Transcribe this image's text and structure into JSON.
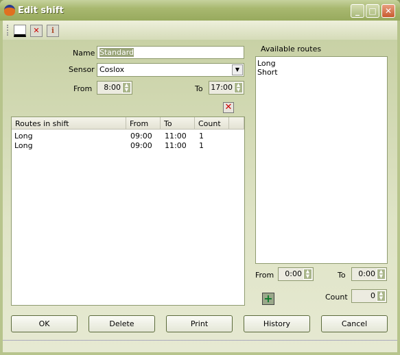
{
  "window": {
    "title": "Edit shift",
    "minimize": "_",
    "maximize": "□",
    "close": "✕"
  },
  "toolbar": {
    "items": [
      {
        "icon": "sensor-icon"
      },
      {
        "icon": "delete-icon"
      },
      {
        "icon": "info-icon"
      }
    ]
  },
  "form": {
    "name_label": "Name",
    "name_value": "Standard",
    "sensor_label": "Sensor",
    "sensor_value": "Coslox",
    "from_label": "From",
    "from_value": "8:00",
    "to_label": "To",
    "to_value": "17:00"
  },
  "routes_table": {
    "columns": [
      "Routes in shift",
      "From",
      "To",
      "Count"
    ],
    "rows": [
      [
        "Long",
        "09:00",
        "11:00",
        "1"
      ],
      [
        "Long",
        "09:00",
        "11:00",
        "1"
      ]
    ]
  },
  "available": {
    "label": "Available routes",
    "items": [
      "Long",
      "Short"
    ],
    "from_label": "From",
    "from_value": "0:00",
    "to_label": "To",
    "to_value": "0:00",
    "count_label": "Count",
    "count_value": "0"
  },
  "buttons": {
    "ok": "OK",
    "delete": "Delete",
    "print": "Print",
    "history": "History",
    "cancel": "Cancel"
  }
}
